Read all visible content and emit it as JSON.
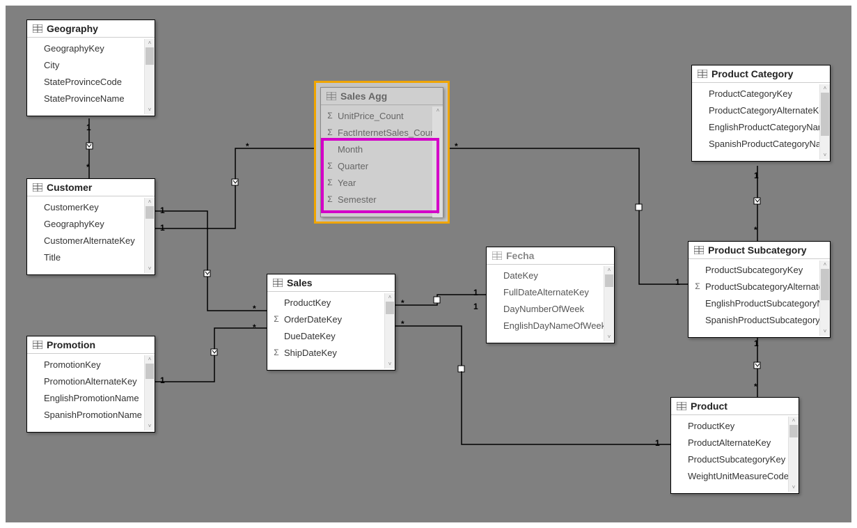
{
  "tables": {
    "geography": {
      "title": "Geography",
      "fields": [
        "GeographyKey",
        "City",
        "StateProvinceCode",
        "StateProvinceName"
      ]
    },
    "customer": {
      "title": "Customer",
      "fields": [
        "CustomerKey",
        "GeographyKey",
        "CustomerAlternateKey",
        "Title"
      ]
    },
    "promotion": {
      "title": "Promotion",
      "fields": [
        "PromotionKey",
        "PromotionAlternateKey",
        "EnglishPromotionName",
        "SpanishPromotionName"
      ]
    },
    "sales_agg": {
      "title": "Sales Agg",
      "fields": [
        {
          "name": "UnitPrice_Count",
          "sigma": true
        },
        {
          "name": "FactInternetSales_Count",
          "sigma": true
        },
        {
          "name": "Month",
          "sigma": false
        },
        {
          "name": "Quarter",
          "sigma": true
        },
        {
          "name": "Year",
          "sigma": true
        },
        {
          "name": "Semester",
          "sigma": true
        }
      ]
    },
    "sales": {
      "title": "Sales",
      "fields": [
        {
          "name": "ProductKey",
          "sigma": false
        },
        {
          "name": "OrderDateKey",
          "sigma": true
        },
        {
          "name": "DueDateKey",
          "sigma": false
        },
        {
          "name": "ShipDateKey",
          "sigma": true
        }
      ]
    },
    "fecha": {
      "title": "Fecha",
      "fields": [
        "DateKey",
        "FullDateAlternateKey",
        "DayNumberOfWeek",
        "EnglishDayNameOfWeek"
      ]
    },
    "product_category": {
      "title": "Product Category",
      "fields": [
        "ProductCategoryKey",
        "ProductCategoryAlternateKey",
        "EnglishProductCategoryName",
        "SpanishProductCategoryName"
      ]
    },
    "product_subcategory": {
      "title": "Product Subcategory",
      "fields": [
        {
          "name": "ProductSubcategoryKey",
          "sigma": false
        },
        {
          "name": "ProductSubcategoryAlternateKey",
          "sigma": true
        },
        {
          "name": "EnglishProductSubcategoryName",
          "sigma": false
        },
        {
          "name": "SpanishProductSubcategoryName",
          "sigma": false
        }
      ]
    },
    "product": {
      "title": "Product",
      "fields": [
        "ProductKey",
        "ProductAlternateKey",
        "ProductSubcategoryKey",
        "WeightUnitMeasureCode"
      ]
    }
  },
  "relationships": [
    {
      "from": "geography",
      "to": "customer",
      "from_card": "1",
      "to_card": "*"
    },
    {
      "from": "customer",
      "to": "sales",
      "from_card": "1",
      "to_card": "*"
    },
    {
      "from": "customer",
      "to": "sales_agg",
      "from_card": "1",
      "to_card": "*"
    },
    {
      "from": "promotion",
      "to": "sales",
      "from_card": "1",
      "to_card": "*"
    },
    {
      "from": "sales_agg",
      "to": "fecha",
      "from_card": "*",
      "to_card": "1"
    },
    {
      "from": "sales",
      "to": "fecha",
      "from_card": "*",
      "to_card": "1"
    },
    {
      "from": "sales",
      "to": "fecha",
      "from_card": "*",
      "to_card": "1"
    },
    {
      "from": "sales",
      "to": "product",
      "from_card": "*",
      "to_card": "1"
    },
    {
      "from": "product_category",
      "to": "product_subcategory",
      "from_card": "1",
      "to_card": "*"
    },
    {
      "from": "product_subcategory",
      "to": "sales_agg",
      "from_card": "1",
      "to_card": "*"
    },
    {
      "from": "product_subcategory",
      "to": "product",
      "from_card": "1",
      "to_card": "*"
    }
  ]
}
